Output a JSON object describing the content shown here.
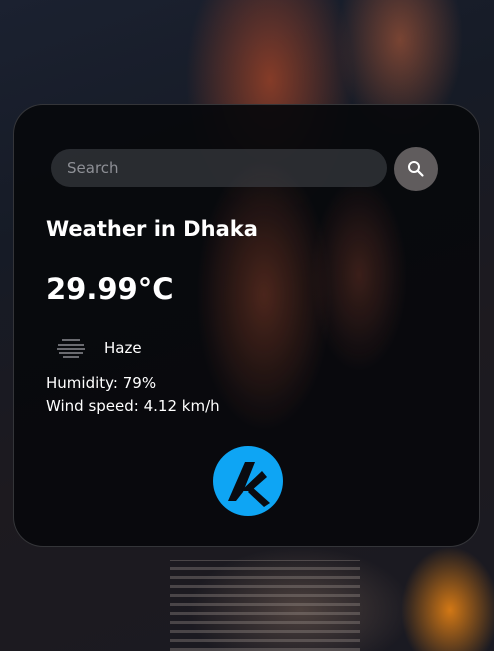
{
  "search": {
    "placeholder": "Search",
    "value": ""
  },
  "weather": {
    "title": "Weather in Dhaka",
    "temperature": "29.99°C",
    "condition": "Haze",
    "condition_icon": "haze-icon",
    "humidity": "Humidity: 79%",
    "wind": "Wind speed: 4.12 km/h"
  },
  "icons": {
    "search": "search-icon",
    "logo": "logo-icon"
  },
  "colors": {
    "logo_accent": "#0ea5f4",
    "card_background": "#08090c",
    "text": "#ffffff"
  }
}
